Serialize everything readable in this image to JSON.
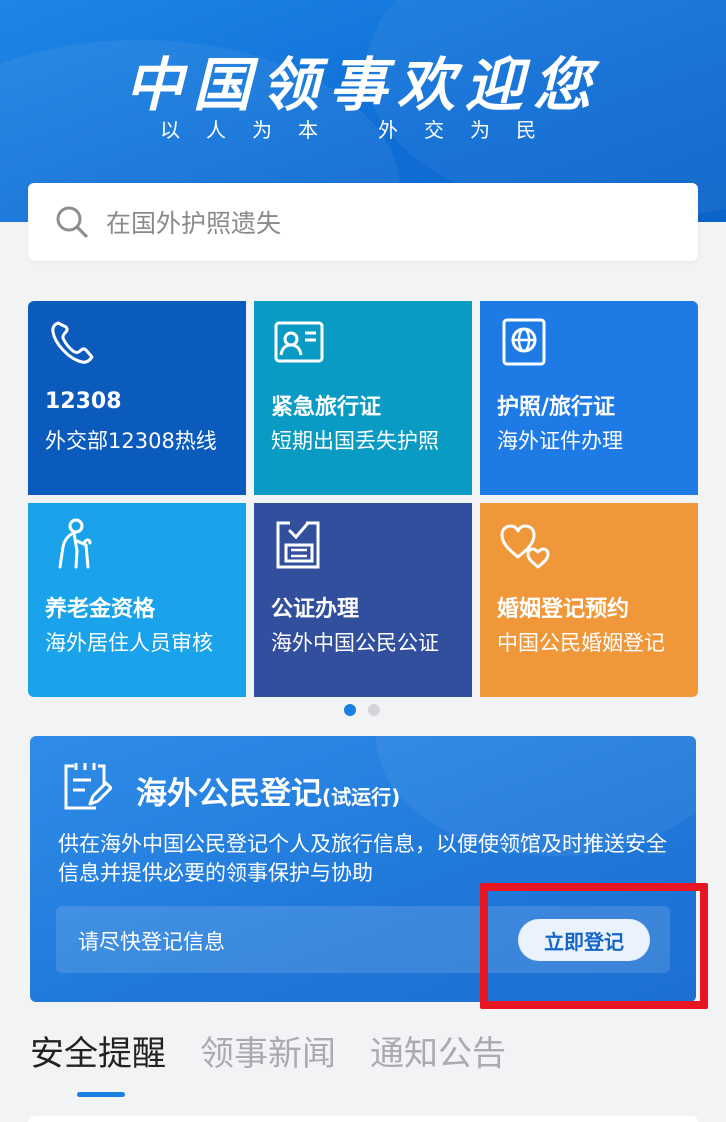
{
  "header": {
    "title": "中国领事欢迎您",
    "slogan_left": "以人为本",
    "slogan_right": "外交为民"
  },
  "search": {
    "placeholder": "在国外护照遗失"
  },
  "services": [
    {
      "title": "12308",
      "subtitle": "外交部12308热线",
      "icon": "phone-icon",
      "color": "#0b5bbd"
    },
    {
      "title": "紧急旅行证",
      "subtitle": "短期出国丢失护照",
      "icon": "id-card-icon",
      "color": "#0a9bc4"
    },
    {
      "title": "护照/旅行证",
      "subtitle": "海外证件办理",
      "icon": "passport-icon",
      "color": "#1e7be6"
    },
    {
      "title": "养老金资格",
      "subtitle": "海外居住人员审核",
      "icon": "elderly-icon",
      "color": "#1aa3ea"
    },
    {
      "title": "公证办理",
      "subtitle": "海外中国公民公证",
      "icon": "notary-icon",
      "color": "#324f9e"
    },
    {
      "title": "婚姻登记预约",
      "subtitle": "中国公民婚姻登记",
      "icon": "hearts-icon",
      "color": "#f0973a"
    }
  ],
  "carousel": {
    "pages": 2,
    "active": 1
  },
  "registration": {
    "title": "海外公民登记",
    "tag": "(试运行)",
    "description": "供在海外中国公民登记个人及旅行信息，以便使领馆及时推送安全信息并提供必要的领事保护与协助",
    "hint": "请尽快登记信息",
    "button": "立即登记",
    "highlight_color": "#e81622"
  },
  "tabs": [
    {
      "label": "安全提醒",
      "active": true
    },
    {
      "label": "领事新闻",
      "active": false
    },
    {
      "label": "通知公告",
      "active": false
    }
  ]
}
